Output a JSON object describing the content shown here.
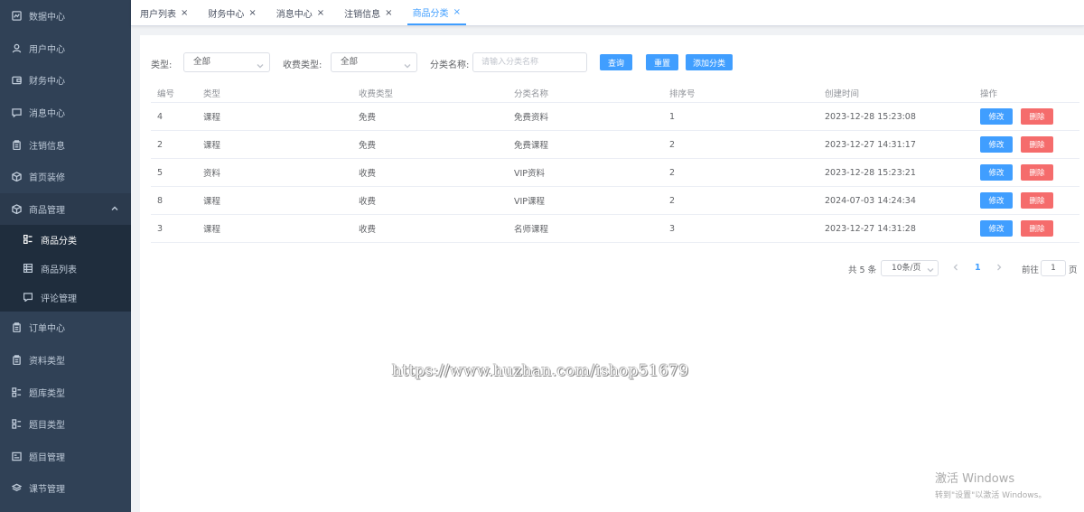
{
  "sidebar": {
    "items": [
      {
        "label": "数据中心",
        "icon": "chart-line-icon"
      },
      {
        "label": "用户中心",
        "icon": "user-icon"
      },
      {
        "label": "财务中心",
        "icon": "wallet-icon"
      },
      {
        "label": "消息中心",
        "icon": "message-icon"
      },
      {
        "label": "注销信息",
        "icon": "clipboard-icon"
      },
      {
        "label": "首页装修",
        "icon": "box-icon"
      },
      {
        "label": "商品管理",
        "icon": "box-icon"
      }
    ],
    "submenu": [
      {
        "label": "商品分类",
        "icon": "grid-icon"
      },
      {
        "label": "商品列表",
        "icon": "table-icon"
      },
      {
        "label": "评论管理",
        "icon": "message-icon"
      }
    ],
    "items_after": [
      {
        "label": "订单中心",
        "icon": "clipboard-icon"
      },
      {
        "label": "资料类型",
        "icon": "clipboard-icon"
      },
      {
        "label": "题库类型",
        "icon": "grid-icon"
      },
      {
        "label": "题目类型",
        "icon": "grid-icon"
      },
      {
        "label": "题目管理",
        "icon": "list-icon"
      },
      {
        "label": "课节管理",
        "icon": "layers-icon"
      }
    ]
  },
  "tabs": [
    {
      "label": "用户列表"
    },
    {
      "label": "财务中心"
    },
    {
      "label": "消息中心"
    },
    {
      "label": "注销信息"
    },
    {
      "label": "商品分类"
    }
  ],
  "filters": {
    "type_label": "类型:",
    "type_value": "全部",
    "fee_label": "收费类型:",
    "fee_value": "全部",
    "name_label": "分类名称:",
    "name_placeholder": "请输入分类名称",
    "query_btn": "查询",
    "reset_btn": "重置",
    "add_btn": "添加分类"
  },
  "table": {
    "headers": [
      "编号",
      "类型",
      "收费类型",
      "分类名称",
      "排序号",
      "创建时间",
      "操作"
    ],
    "rows": [
      [
        "4",
        "课程",
        "免费",
        "免费资料",
        "1",
        "2023-12-28 15:23:08"
      ],
      [
        "2",
        "课程",
        "免费",
        "免费课程",
        "2",
        "2023-12-27 14:31:17"
      ],
      [
        "5",
        "资料",
        "收费",
        "VIP资料",
        "2",
        "2023-12-28 15:23:21"
      ],
      [
        "8",
        "课程",
        "收费",
        "VIP课程",
        "2",
        "2024-07-03 14:24:34"
      ],
      [
        "3",
        "课程",
        "收费",
        "名师课程",
        "3",
        "2023-12-27 14:31:28"
      ]
    ],
    "edit_label": "修改",
    "delete_label": "删除"
  },
  "pagination": {
    "total": "共 5 条",
    "page_size": "10条/页",
    "current_page": "1",
    "goto_label": "前往",
    "goto_value": "1",
    "page_unit": "页"
  },
  "watermark": "https://www.huzhan.com/ishop51679",
  "activation": {
    "line1": "激活 Windows",
    "line2": "转到\"设置\"以激活 Windows。"
  },
  "colors": {
    "sidebar_bg": "#304156",
    "submenu_bg": "#1f2d3d",
    "primary": "#409eff",
    "danger": "#f56c6c"
  }
}
